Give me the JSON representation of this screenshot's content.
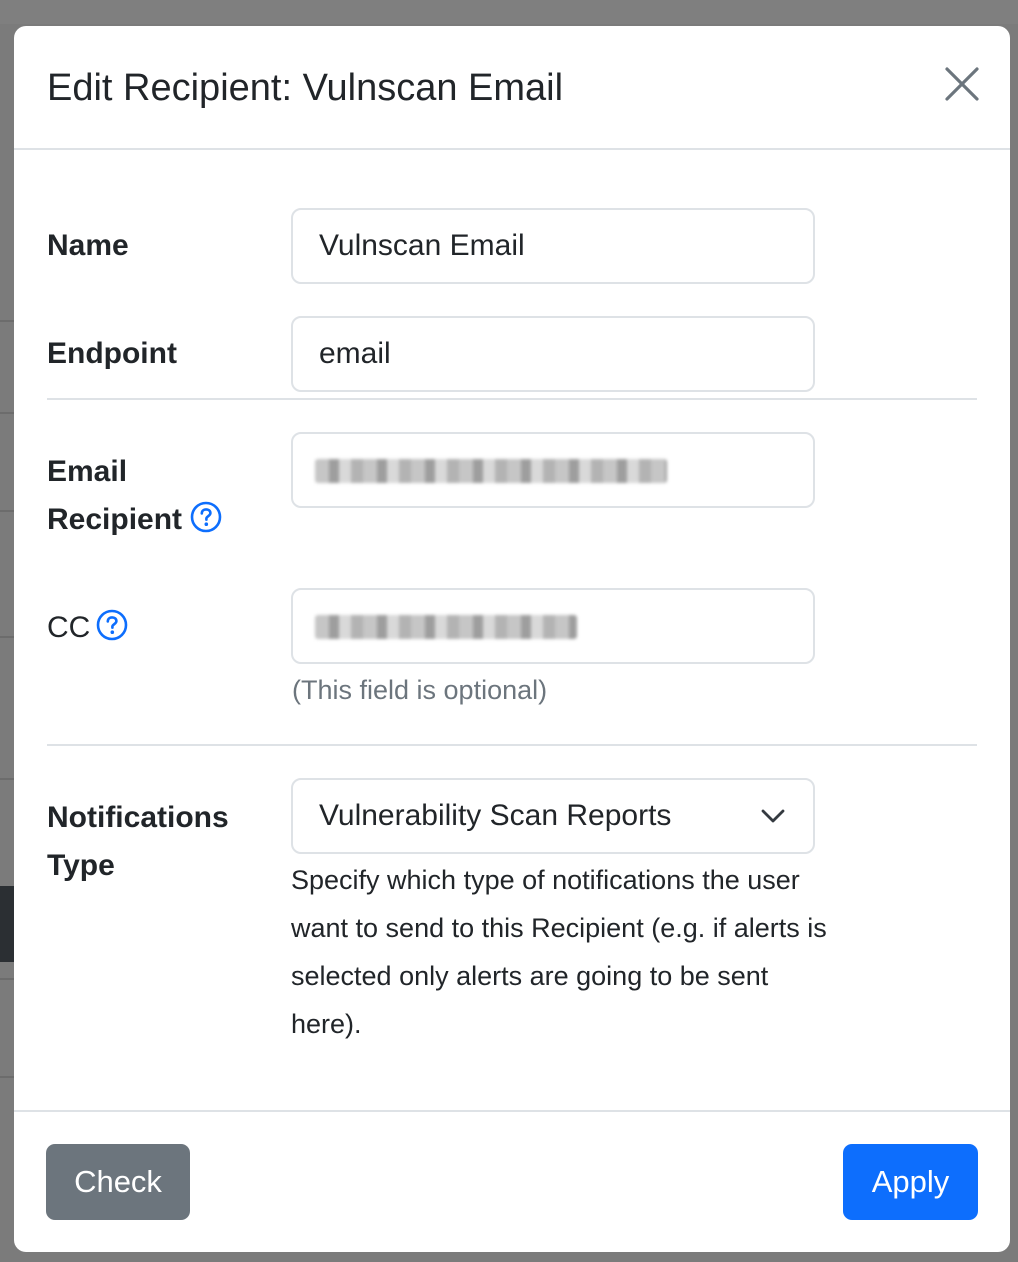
{
  "modal": {
    "title": "Edit Recipient: Vulnscan Email"
  },
  "form": {
    "name_label": "Name",
    "name_value": "Vulnscan Email",
    "endpoint_label": "Endpoint",
    "endpoint_value": "email",
    "email_recipient_label_line1": "Email",
    "email_recipient_label_line2": "Recipient",
    "cc_label": "CC",
    "cc_hint": "(This field is optional)",
    "notifications_type_label_line1": "Notifications",
    "notifications_type_label_line2": "Type",
    "notifications_type_value": "Vulnerability Scan Reports",
    "notifications_type_desc": "Specify which type of notifications the user want to send to this Recipient (e.g. if alerts is selected only alerts are going to be sent here)."
  },
  "footer": {
    "check_label": "Check",
    "apply_label": "Apply"
  },
  "colors": {
    "primary": "#0d6efd",
    "secondary": "#6c757d",
    "help_icon": "#0d6efd"
  },
  "icons": {
    "close": "close-icon",
    "help": "question-circle-icon",
    "select": "chevron-down-icon"
  }
}
